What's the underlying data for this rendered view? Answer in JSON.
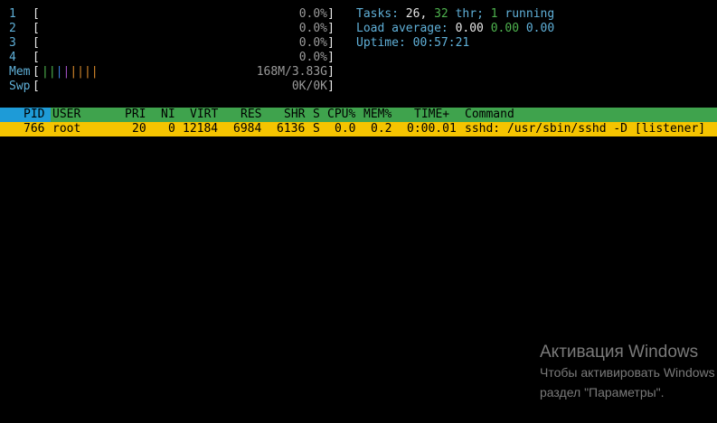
{
  "cpu_meters": [
    {
      "label": "1",
      "value": "0.0%"
    },
    {
      "label": "2",
      "value": "0.0%"
    },
    {
      "label": "3",
      "value": "0.0%"
    },
    {
      "label": "4",
      "value": "0.0%"
    }
  ],
  "mem": {
    "label": "Mem",
    "bars": "||||||||",
    "value": "168M/3.83G"
  },
  "swp": {
    "label": "Swp",
    "value": "0K/0K"
  },
  "summary": {
    "tasks_label": "Tasks:",
    "tasks_count": "26,",
    "threads_count": "32",
    "threads_label": "thr;",
    "running_count": "1",
    "running_label": "running",
    "load_label": "Load average:",
    "load_1": "0.00",
    "load_5": "0.00",
    "load_15": "0.00",
    "uptime_label": "Uptime:",
    "uptime_value": "00:57:21"
  },
  "columns": {
    "pid": "PID",
    "user": "USER",
    "pri": "PRI",
    "ni": "NI",
    "virt": "VIRT",
    "res": "RES",
    "shr": "SHR",
    "s": "S",
    "cpu": "CPU%",
    "mem": "MEM%",
    "time": "TIME+",
    "command": "Command"
  },
  "processes": [
    {
      "pid": "766",
      "user": "root",
      "pri": "20",
      "ni": "0",
      "virt": "12184",
      "res": "6984",
      "shr": "6136",
      "s": "S",
      "cpu": "0.0",
      "mem": "0.2",
      "time": "0:00.01",
      "command": "sshd: /usr/sbin/sshd -D [listener]"
    }
  ],
  "watermark": {
    "title": "Активация Windows",
    "line1": "Чтобы активировать Windows",
    "line2": "раздел \"Параметры\"."
  },
  "colors": {
    "background": "#000000",
    "header_bg": "#3fa34d",
    "pid_header_bg": "#1e9bd7",
    "selected_row_bg": "#f5c400",
    "label_blue": "#5fafd7",
    "value_green": "#4eb34e"
  }
}
